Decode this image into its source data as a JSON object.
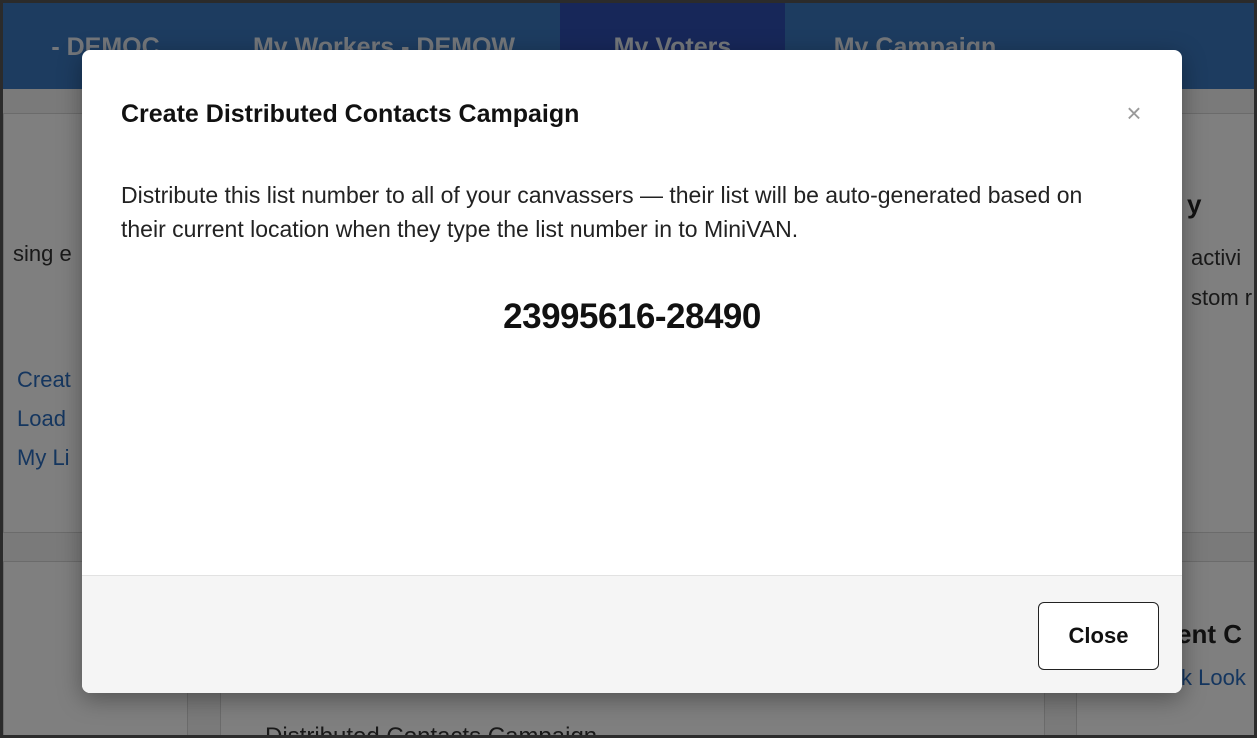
{
  "nav": {
    "items": [
      {
        "label": "- DEMOC",
        "active": false
      },
      {
        "label": "My Workers - DEMOW",
        "active": false
      },
      {
        "label": "My Voters",
        "active": true
      },
      {
        "label": "My Campaign",
        "active": false
      }
    ]
  },
  "background": {
    "left_text": "sing e",
    "links": [
      "Creat",
      "Load",
      "My Li"
    ],
    "right_heading": "y",
    "right_text_1": "activi",
    "right_text_2": "stom r",
    "right_lower_heading": "ent C",
    "right_lower_link": "k Look",
    "bottom_text": "Distributed Contacts Campaign"
  },
  "modal": {
    "title": "Create Distributed Contacts Campaign",
    "close_icon": "×",
    "body": "Distribute this list number to all of your canvassers — their list will be auto-generated based on their current location when they type the list number in to MiniVAN.",
    "list_number": "23995616-28490",
    "list_number_prefix": "",
    "close_button": "Close"
  },
  "colors": {
    "nav_bg": "#3a78c0",
    "nav_active": "#2f4fb3",
    "link": "#2a6cbf"
  }
}
